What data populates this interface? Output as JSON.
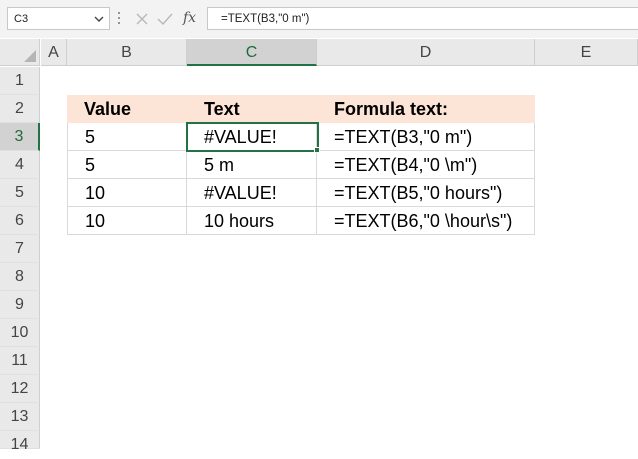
{
  "name_box": {
    "value": "C3",
    "chevron": "⌄"
  },
  "formula_bar": {
    "cancel_icon": "✕",
    "enter_icon": "✓",
    "fx_label": "fx",
    "formula": "=TEXT(B3,\"0 m\")"
  },
  "columns": [
    "A",
    "B",
    "C",
    "D",
    "E"
  ],
  "rows": [
    "1",
    "2",
    "3",
    "4",
    "5",
    "6",
    "7",
    "8",
    "9",
    "10",
    "11",
    "12",
    "13",
    "14"
  ],
  "active_cell": "C3",
  "table": {
    "headers": [
      "Value",
      "Text",
      "Formula text:"
    ],
    "rows": [
      [
        "5",
        "#VALUE!",
        "=TEXT(B3,\"0 m\")"
      ],
      [
        "5",
        "5 m",
        "=TEXT(B4,\"0 \\m\")"
      ],
      [
        "10",
        "#VALUE!",
        "=TEXT(B5,\"0 hours\")"
      ],
      [
        "10",
        "10 hours",
        "=TEXT(B6,\"0 \\hour\\s\")"
      ]
    ]
  },
  "colors": {
    "accent": "#217346",
    "header_fill": "#fce4d6"
  }
}
